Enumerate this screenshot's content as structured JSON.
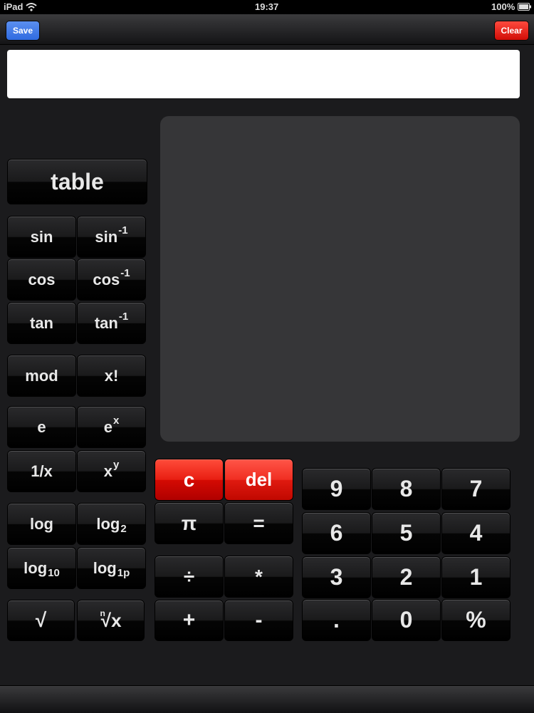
{
  "status_bar": {
    "device": "iPad",
    "time": "19:37",
    "battery": "100%"
  },
  "toolbar": {
    "save_label": "Save",
    "clear_label": "Clear"
  },
  "keys": {
    "table": "table",
    "sin": "sin",
    "asin_base": "sin",
    "asin_sup": "-1",
    "cos": "cos",
    "acos_base": "cos",
    "acos_sup": "-1",
    "tan": "tan",
    "atan_base": "tan",
    "atan_sup": "-1",
    "mod": "mod",
    "fact": "x!",
    "e": "e",
    "exp_base": "e",
    "exp_sup": "x",
    "recip": "1/x",
    "pow_base": "x",
    "pow_sup": "y",
    "log": "log",
    "log2_base": "log",
    "log2_sub": "2",
    "log10_base": "log",
    "log10_sub": "10",
    "log1p_base": "log",
    "log1p_sub": "1p",
    "sqrt": "√",
    "nroot_index": "n",
    "nroot_base": "√x",
    "c": "c",
    "del": "del",
    "pi": "π",
    "equals": "=",
    "divide": "÷",
    "multiply": "*",
    "plus": "+",
    "minus": "-",
    "d9": "9",
    "d8": "8",
    "d7": "7",
    "d6": "6",
    "d5": "5",
    "d4": "4",
    "d3": "3",
    "d2": "2",
    "d1": "1",
    "dot": ".",
    "d0": "0",
    "percent": "%"
  },
  "colors": {
    "save": "#2f6be0",
    "clear": "#e8140e",
    "red_key": "#e81e12"
  },
  "icons": [
    "wifi-icon",
    "battery-icon"
  ]
}
